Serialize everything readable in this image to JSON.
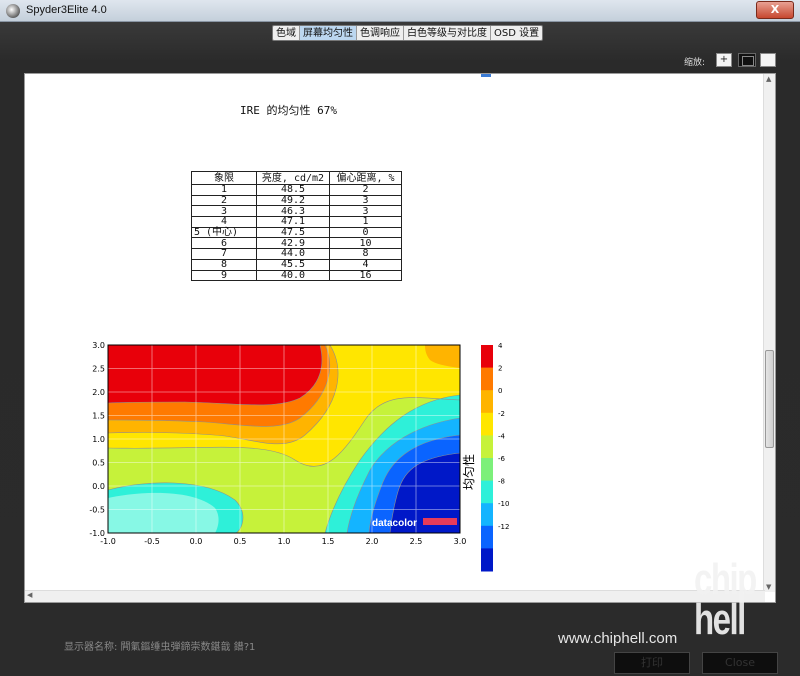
{
  "window": {
    "title": "Spyder3Elite 4.0",
    "close_label": "X"
  },
  "tabs": [
    {
      "label": "色域",
      "active": false
    },
    {
      "label": "屏幕均匀性",
      "active": true
    },
    {
      "label": "色调响应",
      "active": false
    },
    {
      "label": "白色等级与对比度",
      "active": false
    },
    {
      "label": "OSD 设置",
      "active": false
    }
  ],
  "zoom": {
    "label": "缩放:",
    "plus_label": "+"
  },
  "report": {
    "title": "IRE 的均匀性 67%",
    "table": {
      "headers": [
        "象限",
        "亮度, cd/m2",
        "偏心距离, %"
      ],
      "rows": [
        [
          "1",
          "48.5",
          "2"
        ],
        [
          "2",
          "49.2",
          "3"
        ],
        [
          "3",
          "46.3",
          "3"
        ],
        [
          "4",
          "47.1",
          "1"
        ],
        [
          "5 (中心)",
          "47.5",
          "0"
        ],
        [
          "6",
          "42.9",
          "10"
        ],
        [
          "7",
          "44.0",
          "8"
        ],
        [
          "8",
          "45.5",
          "4"
        ],
        [
          "9",
          "40.0",
          "16"
        ]
      ]
    }
  },
  "chart_data": {
    "type": "heatmap",
    "xlim": [
      -1.0,
      3.0
    ],
    "ylim": [
      -1.0,
      3.0
    ],
    "x_ticks": [
      "-1.0",
      "-0.5",
      "0.0",
      "0.5",
      "1.0",
      "1.5",
      "2.0",
      "2.5",
      "3.0"
    ],
    "y_ticks": [
      "3.0",
      "2.5",
      "2.0",
      "1.5",
      "1.0",
      "0.5",
      "0.0",
      "-0.5",
      "-1.0"
    ],
    "colorbar_label": "均匀性",
    "colorbar_ticks": [
      "4",
      "2",
      "0",
      "-2",
      "-4",
      "-6",
      "-8",
      "-10",
      "-12"
    ],
    "colorbar_colors": [
      "#e8000a",
      "#ff7a00",
      "#ffb400",
      "#ffe600",
      "#c6f23a",
      "#7cf07a",
      "#2ef0d9",
      "#14b4ff",
      "#0a64ff",
      "#0018c8"
    ],
    "grid": true,
    "watermark": "datacolor"
  },
  "bottom": {
    "monitor_label": "显示器名称: 闁氭鏂缍虫弾鍗崇数鍖戠   鐠?1",
    "print_label": "打印",
    "close_label": "Close"
  },
  "watermark": {
    "url": "www.chiphell.com",
    "logo": "chip hell"
  }
}
